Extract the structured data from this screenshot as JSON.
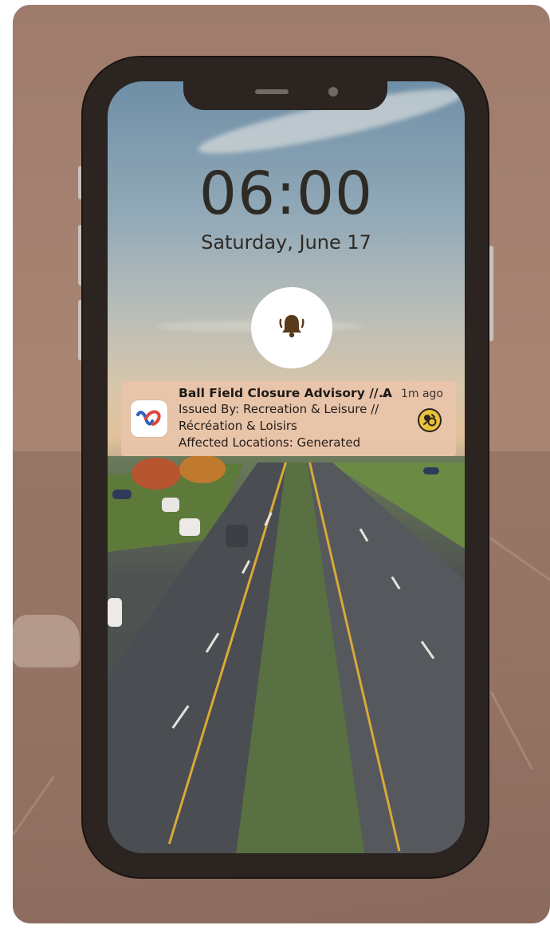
{
  "lockscreen": {
    "time": "06:00",
    "date": "Saturday, June 17"
  },
  "notification": {
    "title": "Ball Field Closure Advisory // A",
    "ellipsis": "...",
    "time_ago": "1m ago",
    "line1": "Issued By: Recreation & Leisure //",
    "line2": "Récréation & Loisirs",
    "line3": "Affected Locations: Generated"
  },
  "icons": {
    "bell": "bell-icon",
    "app": "app-logo-icon",
    "category": "recreation-badge-icon"
  },
  "colors": {
    "frame": "#2b2420",
    "backdrop": "#9a7160",
    "bell": "#5a3a1c",
    "badge": "#e9c13a"
  }
}
